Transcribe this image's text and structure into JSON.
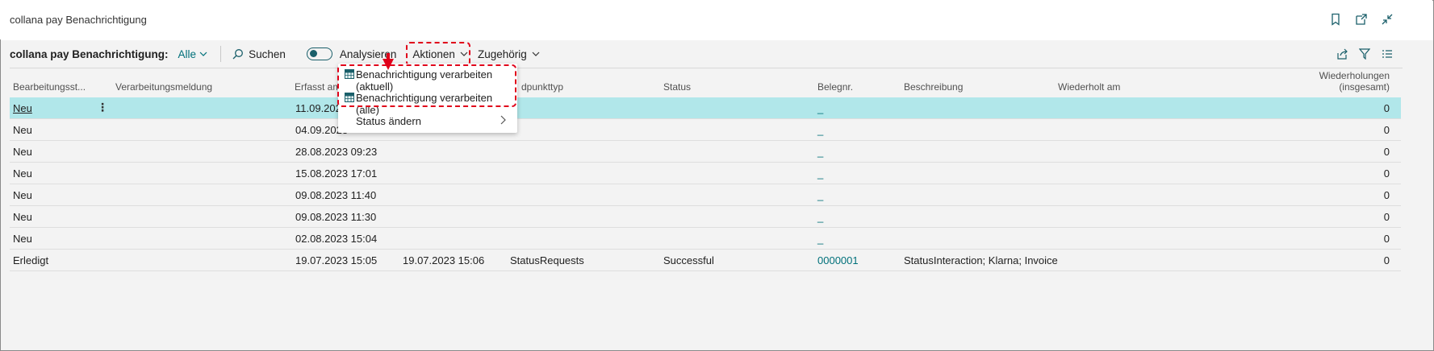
{
  "window": {
    "title": "collana pay Benachrichtigung"
  },
  "actionbar": {
    "list_name": "collana pay Benachrichtigung:",
    "view": "Alle",
    "search_label": "Suchen",
    "analyse_label": "Analysieren",
    "aktionen_label": "Aktionen",
    "zugehoerig_label": "Zugehörig"
  },
  "menu": {
    "items": [
      {
        "label": "Benachrichtigung verarbeiten (aktuell)"
      },
      {
        "label": "Benachrichtigung verarbeiten (alle)"
      },
      {
        "label": "Status ändern"
      }
    ]
  },
  "table": {
    "columns": {
      "bearbeitungsstatus": "Bearbeitungsst...",
      "verarbeitungsmeldung": "Verarbeitungsmeldung",
      "erfasst_am": "Erfasst am",
      "endpunkttyp": "dpunkttyp",
      "status": "Status",
      "belegnr": "Belegnr.",
      "beschreibung": "Beschreibung",
      "wiederholt_am": "Wiederholt am",
      "wiederholungen_l1": "Wiederholungen",
      "wiederholungen_l2": "(insgesamt)"
    },
    "rows": [
      {
        "status_proc": "Neu",
        "erfasst": "11.09.2023",
        "verarbeitet": "",
        "endpunkt": "",
        "status": "",
        "belegnr": "_",
        "beschreibung": "",
        "wiederholungen": "0"
      },
      {
        "status_proc": "Neu",
        "erfasst": "04.09.2023",
        "verarbeitet": "",
        "endpunkt": "",
        "status": "",
        "belegnr": "_",
        "beschreibung": "",
        "wiederholungen": "0"
      },
      {
        "status_proc": "Neu",
        "erfasst": "28.08.2023 09:23",
        "verarbeitet": "",
        "endpunkt": "",
        "status": "",
        "belegnr": "_",
        "beschreibung": "",
        "wiederholungen": "0"
      },
      {
        "status_proc": "Neu",
        "erfasst": "15.08.2023 17:01",
        "verarbeitet": "",
        "endpunkt": "",
        "status": "",
        "belegnr": "_",
        "beschreibung": "",
        "wiederholungen": "0"
      },
      {
        "status_proc": "Neu",
        "erfasst": "09.08.2023 11:40",
        "verarbeitet": "",
        "endpunkt": "",
        "status": "",
        "belegnr": "_",
        "beschreibung": "",
        "wiederholungen": "0"
      },
      {
        "status_proc": "Neu",
        "erfasst": "09.08.2023 11:30",
        "verarbeitet": "",
        "endpunkt": "",
        "status": "",
        "belegnr": "_",
        "beschreibung": "",
        "wiederholungen": "0"
      },
      {
        "status_proc": "Neu",
        "erfasst": "02.08.2023 15:04",
        "verarbeitet": "",
        "endpunkt": "",
        "status": "",
        "belegnr": "_",
        "beschreibung": "",
        "wiederholungen": "0"
      },
      {
        "status_proc": "Erledigt",
        "erfasst": "19.07.2023 15:05",
        "verarbeitet": "19.07.2023 15:06",
        "endpunkt": "StatusRequests",
        "status": "Successful",
        "belegnr": "0000001",
        "beschreibung": "StatusInteraction;  Klarna; Invoice",
        "wiederholungen": "0"
      }
    ]
  },
  "colors": {
    "accent": "#00707a",
    "selected_row": "#b1e7ea",
    "highlight": "#e0001a"
  },
  "icons": [
    "bookmark-icon",
    "open-new-window-icon",
    "collapse-icon",
    "search-icon",
    "chevron-down-icon",
    "share-icon",
    "filter-icon",
    "list-view-icon",
    "table-icon",
    "chevron-right-icon",
    "more-options-icon"
  ]
}
